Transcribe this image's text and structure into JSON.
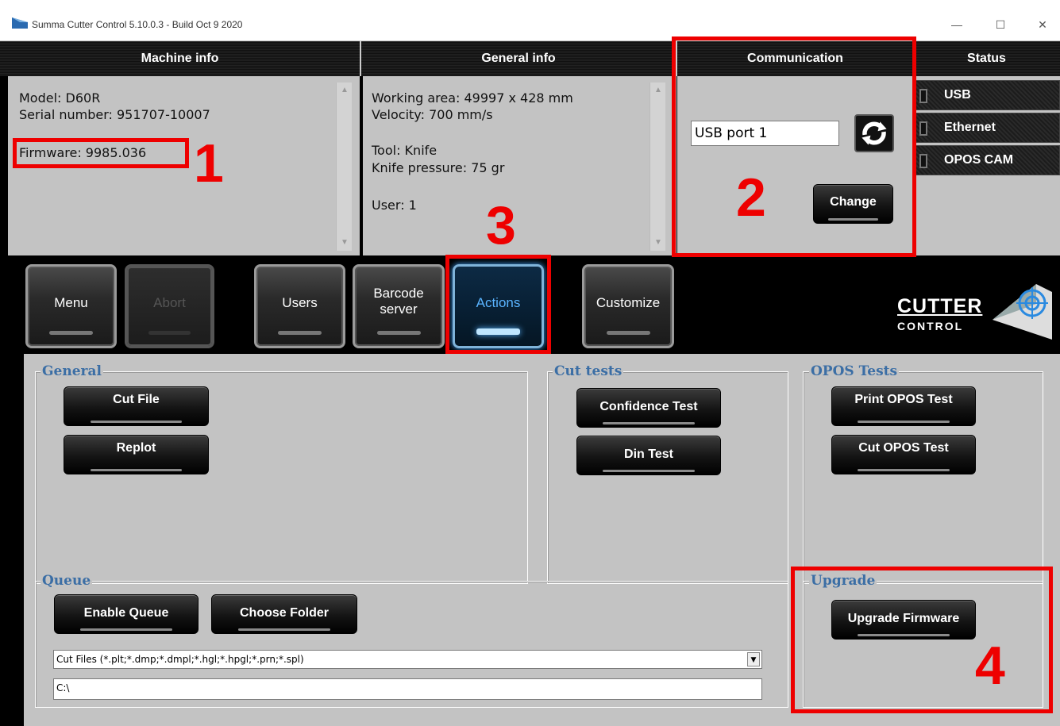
{
  "window": {
    "title": "Summa Cutter Control 5.10.0.3 - Build Oct  9 2020",
    "minimize_glyph": "—",
    "maximize_glyph": "☐",
    "close_glyph": "✕"
  },
  "headers": {
    "machine_info": "Machine info",
    "general_info": "General info",
    "communication": "Communication",
    "status": "Status"
  },
  "machine_info": {
    "model": "Model: D60R",
    "serial": "Serial number: 951707-10007",
    "firmware": "Firmware: 9985.036"
  },
  "general_info": {
    "working_area": "Working area: 49997 x 428 mm",
    "velocity": "Velocity: 700 mm/s",
    "tool": "Tool: Knife",
    "knife_pressure": "Knife pressure: 75 gr",
    "user": "User: 1"
  },
  "communication": {
    "port_value": "USB port 1",
    "change_label": "Change",
    "refresh_icon": "refresh-icon"
  },
  "status": {
    "items": [
      {
        "label": "USB"
      },
      {
        "label": "Ethernet"
      },
      {
        "label": "OPOS CAM"
      }
    ]
  },
  "toolbar": {
    "menu": "Menu",
    "abort": "Abort",
    "users": "Users",
    "barcode_line1": "Barcode",
    "barcode_line2": "server",
    "actions": "Actions",
    "customize": "Customize",
    "logo_line1": "CUTTER",
    "logo_line2": "CONTROL",
    "active_tab": "Actions"
  },
  "groups": {
    "general": {
      "title": "General",
      "cut_file": "Cut File",
      "replot": "Replot"
    },
    "cut_tests": {
      "title": "Cut tests",
      "confidence": "Confidence Test",
      "din": "Din Test"
    },
    "opos_tests": {
      "title": "OPOS Tests",
      "print": "Print OPOS Test",
      "cut": "Cut OPOS Test"
    },
    "queue": {
      "title": "Queue",
      "enable": "Enable Queue",
      "choose_folder": "Choose Folder",
      "file_filter": "Cut Files (*.plt;*.dmp;*.dmpl;*.hgl;*.hpgl;*.prn;*.spl)",
      "path": "C:\\"
    },
    "upgrade": {
      "title": "Upgrade",
      "upgrade_firmware": "Upgrade Firmware"
    }
  },
  "annotations": {
    "n1": "1",
    "n2": "2",
    "n3": "3",
    "n4": "4",
    "color": "#ee0000"
  },
  "colors": {
    "group_title": "#3b6ea5",
    "panel_bg": "#c3c3c3",
    "active_glow": "#5ab4ff"
  }
}
